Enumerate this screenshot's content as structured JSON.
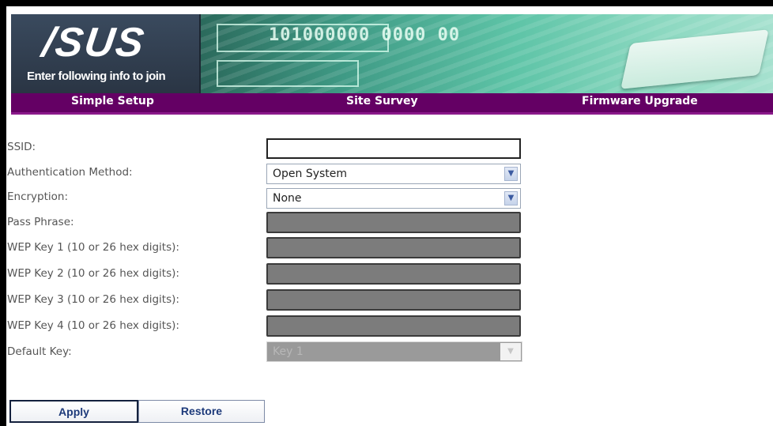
{
  "banner": {
    "logo": "/SUS",
    "tagline": "Enter following info to join",
    "digits": "101000000 0000 00"
  },
  "nav": {
    "items": [
      "Simple Setup",
      "Site Survey",
      "Firmware Upgrade"
    ]
  },
  "form": {
    "ssid": {
      "label": "SSID:",
      "value": ""
    },
    "auth": {
      "label": "Authentication Method:",
      "value": "Open System"
    },
    "encryption": {
      "label": "Encryption:",
      "value": "None"
    },
    "pass_phrase": {
      "label": "Pass Phrase:"
    },
    "wep1": {
      "label": "WEP Key 1 (10 or 26 hex digits):"
    },
    "wep2": {
      "label": "WEP Key 2 (10 or 26 hex digits):"
    },
    "wep3": {
      "label": "WEP Key 3 (10 or 26 hex digits):"
    },
    "wep4": {
      "label": "WEP Key 4 (10 or 26 hex digits):"
    },
    "default_key": {
      "label": "Default Key:",
      "value": "Key 1"
    }
  },
  "buttons": {
    "apply": "Apply",
    "restore": "Restore"
  },
  "colors": {
    "nav_bg": "#640064",
    "disabled_field": "#7c7c7c"
  }
}
